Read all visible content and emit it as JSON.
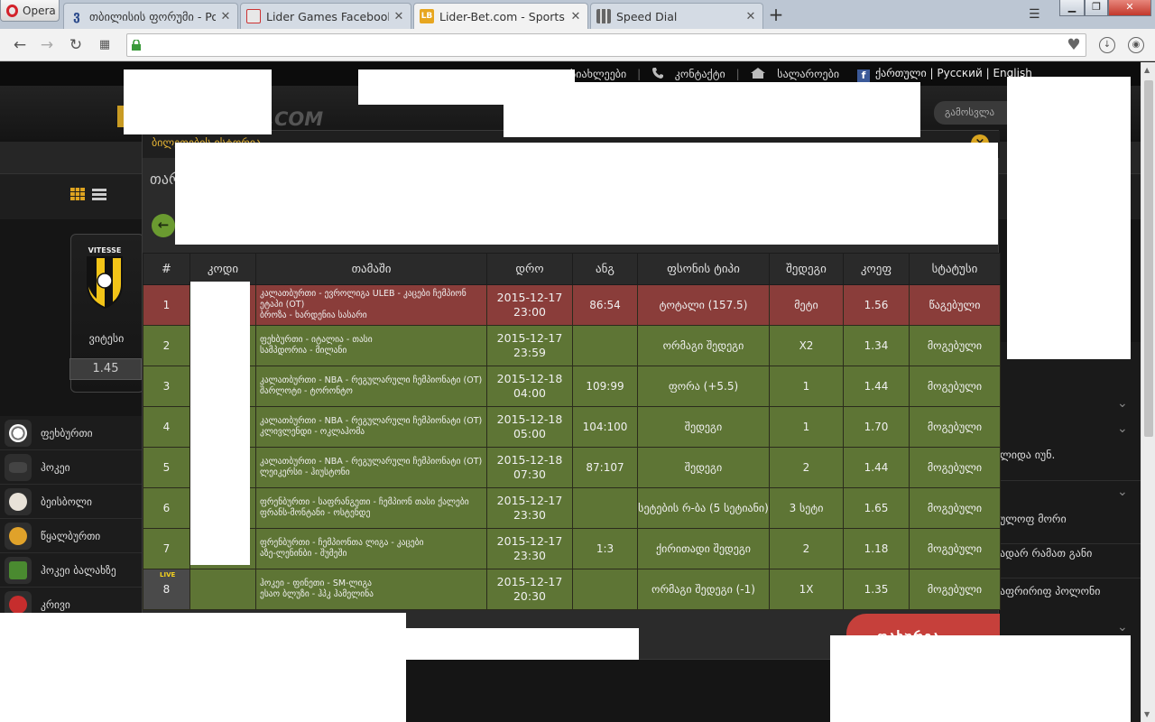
{
  "browser": {
    "opera_label": "Opera",
    "tabs": [
      {
        "title": "თბილისის ფორუმი - Pov",
        "icon": "forum-icon"
      },
      {
        "title": "Lider Games Facebook–ზე",
        "icon": "lider-games-icon"
      },
      {
        "title": "Lider-Bet.com - Sports and",
        "icon": "liderbet-icon",
        "active": true
      },
      {
        "title": "Speed Dial",
        "icon": "speed-dial-icon"
      }
    ],
    "new_tab": "+"
  },
  "site": {
    "top_links": {
      "results": "სიახლეები",
      "contact": "კონტაქტი",
      "home": "სალაროები"
    },
    "languages": {
      "ka": "ქართული",
      "ru": "Русский",
      "en": "English",
      "sep": "|"
    },
    "logo_suffix": ".COM",
    "header_button": "გამოსვლა",
    "team": {
      "name": "ვიტესი",
      "odds": "1.45",
      "logo_text": "VITESSE"
    },
    "sports": [
      {
        "label": "ფეხბურთი",
        "color": "#ffffff"
      },
      {
        "label": "ჰოკეი",
        "color": "#333333"
      },
      {
        "label": "ბეისბოლი",
        "color": "#e8e2d8"
      },
      {
        "label": "წყალბურთი",
        "color": "#e0a22a"
      },
      {
        "label": "ჰოკეი ბალახზე",
        "color": "#4a8a30"
      },
      {
        "label": "კრივი",
        "color": "#c62d2d"
      }
    ],
    "right_panel": [
      "ლიდა იუნ.",
      "ულოფ მორი",
      "ადარ რამათ განი",
      "აფრირიფ პოლონი"
    ]
  },
  "modal": {
    "title": "ბილეთების ისტორია",
    "tab_hint": "თარ",
    "close_label": "×",
    "back_label": "←",
    "columns": [
      "#",
      "კოდი",
      "თამაში",
      "დრო",
      "ანგ",
      "ფსონის ტიპი",
      "შედეგი",
      "კოეფ",
      "სტატუსი"
    ],
    "rows": [
      {
        "n": "1",
        "match": "კალათბურთი - ევროლიგა ULEB - კაცები ჩემპიონ ეტაპი (OT)",
        "teams": "ბროზა - ხარდენია სასარი",
        "date": "2015-12-17",
        "time": "23:00",
        "score": "86:54",
        "bet_type": "ტოტალი (157.5)",
        "result": "მეტი",
        "odds": "1.56",
        "status": "წაგებული",
        "state": "lost"
      },
      {
        "n": "2",
        "match": "ფეხბურთი - იტალია - თასი",
        "teams": "სამპდორია - მილანი",
        "date": "2015-12-17",
        "time": "23:59",
        "score": "",
        "bet_type": "ორმაგი შედეგი",
        "result": "X2",
        "odds": "1.34",
        "status": "მოგებული",
        "state": "won"
      },
      {
        "n": "3",
        "match": "კალათბურთი - NBA - რეგულარული ჩემპიონატი (OT)",
        "teams": "შარლოტი - ტორონტო",
        "date": "2015-12-18",
        "time": "04:00",
        "score": "109:99",
        "bet_type": "ფორა (+5.5)",
        "result": "1",
        "odds": "1.44",
        "status": "მოგებული",
        "state": "won"
      },
      {
        "n": "4",
        "match": "კალათბურთი - NBA - რეგულარული ჩემპიონატი (OT)",
        "teams": "კლივლენდი - ოკლაჰომა",
        "date": "2015-12-18",
        "time": "05:00",
        "score": "104:100",
        "bet_type": "შედეგი",
        "result": "1",
        "odds": "1.70",
        "status": "მოგებული",
        "state": "won"
      },
      {
        "n": "5",
        "match": "კალათბურთი - NBA - რეგულარული ჩემპიონატი (OT)",
        "teams": "ლეიკერსი - ჰიუსტონი",
        "date": "2015-12-18",
        "time": "07:30",
        "score": "87:107",
        "bet_type": "შედეგი",
        "result": "2",
        "odds": "1.44",
        "status": "მოგებული",
        "state": "won"
      },
      {
        "n": "6",
        "match": "ფრენბურთი - საფრანგეთი - ჩემპიონ თასი ქალები",
        "teams": "ფრანს-მონტანი - ოსტენდე",
        "date": "2015-12-17",
        "time": "23:30",
        "score": "",
        "bet_type": "სეტების რ-ბა (5 სეტიანი)",
        "result": "3 სეტი",
        "odds": "1.65",
        "status": "მოგებული",
        "state": "won"
      },
      {
        "n": "7",
        "match": "ფრენბურთი - ჩემპიონთა ლიგა - კაცები",
        "teams": "აზე-ლენინბი - შუმეში",
        "date": "2015-12-17",
        "time": "23:30",
        "score": "1:3",
        "bet_type": "ქირითადი შედეგი",
        "result": "2",
        "odds": "1.18",
        "status": "მოგებული",
        "state": "won"
      },
      {
        "n": "8",
        "live": "LIVE",
        "match": "ჰოკეი - ფინეთი - SM-ლიგა",
        "teams": "ესაო ბლუზი - ჰპკ ჰამელინა",
        "date": "2015-12-17",
        "time": "20:30",
        "score": "",
        "bet_type": "ორმაგი შედეგი (-1)",
        "result": "1X",
        "odds": "1.35",
        "status": "მოგებული",
        "state": "won"
      }
    ],
    "bottom_button": "დახურვა"
  }
}
